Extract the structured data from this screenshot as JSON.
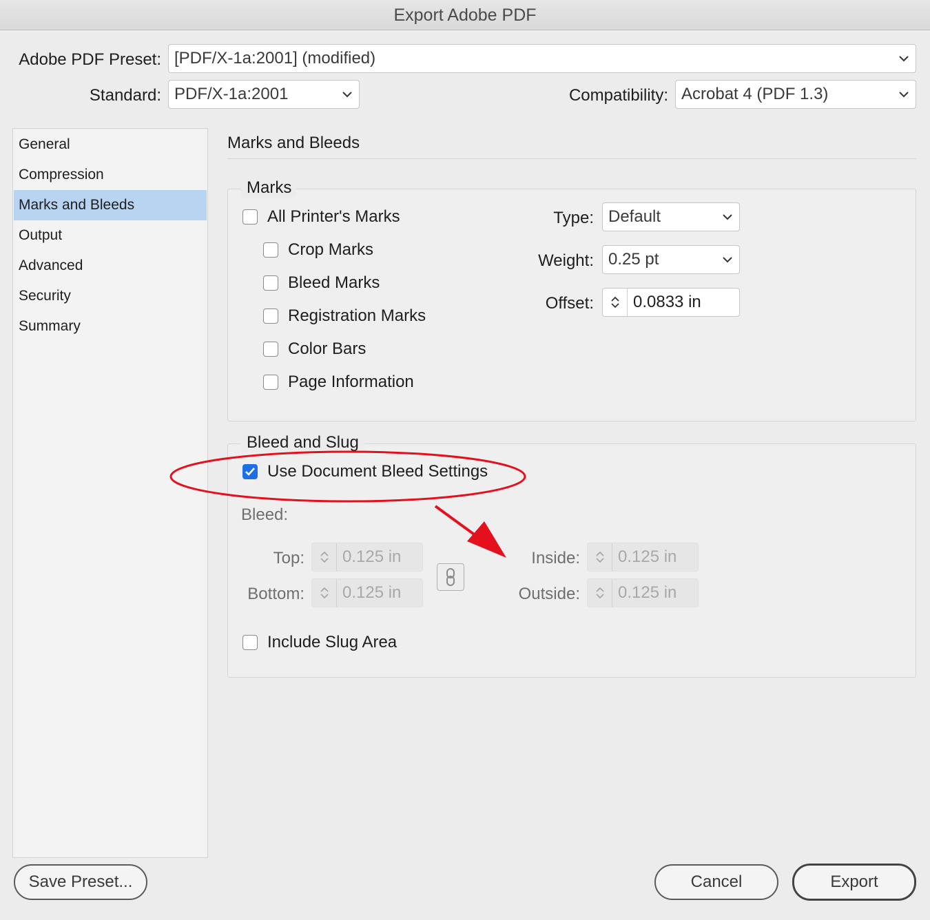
{
  "window": {
    "title": "Export Adobe PDF"
  },
  "preset": {
    "label": "Adobe PDF Preset:",
    "value": "[PDF/X-1a:2001] (modified)"
  },
  "standard": {
    "label": "Standard:",
    "value": "PDF/X-1a:2001"
  },
  "compatibility": {
    "label": "Compatibility:",
    "value": "Acrobat 4 (PDF 1.3)"
  },
  "sidebar": {
    "items": [
      {
        "label": "General"
      },
      {
        "label": "Compression"
      },
      {
        "label": "Marks and Bleeds",
        "selected": true
      },
      {
        "label": "Output"
      },
      {
        "label": "Advanced"
      },
      {
        "label": "Security"
      },
      {
        "label": "Summary"
      }
    ]
  },
  "main": {
    "heading": "Marks and Bleeds",
    "marks": {
      "title": "Marks",
      "all_printers_marks": {
        "label": "All Printer's Marks",
        "checked": false
      },
      "crop_marks": {
        "label": "Crop Marks",
        "checked": false
      },
      "bleed_marks": {
        "label": "Bleed Marks",
        "checked": false
      },
      "registration_marks": {
        "label": "Registration Marks",
        "checked": false
      },
      "color_bars": {
        "label": "Color Bars",
        "checked": false
      },
      "page_information": {
        "label": "Page Information",
        "checked": false
      },
      "type": {
        "label": "Type:",
        "value": "Default"
      },
      "weight": {
        "label": "Weight:",
        "value": "0.25 pt"
      },
      "offset": {
        "label": "Offset:",
        "value": "0.0833 in"
      }
    },
    "bleed_slug": {
      "title": "Bleed and Slug",
      "use_document_bleed": {
        "label": "Use Document Bleed Settings",
        "checked": true
      },
      "bleed_label": "Bleed:",
      "top": {
        "label": "Top:",
        "value": "0.125 in"
      },
      "bottom": {
        "label": "Bottom:",
        "value": "0.125 in"
      },
      "inside": {
        "label": "Inside:",
        "value": "0.125 in"
      },
      "outside": {
        "label": "Outside:",
        "value": "0.125 in"
      },
      "include_slug": {
        "label": "Include Slug Area",
        "checked": false
      }
    }
  },
  "footer": {
    "save_preset": "Save Preset...",
    "cancel": "Cancel",
    "export": "Export"
  },
  "colors": {
    "selection": "#b9d4f0",
    "checkbox_on": "#1e6fe6",
    "annotation": "#e4101e"
  },
  "icons": [
    "chevron-down-icon",
    "stepper-arrows-icon",
    "link-chain-icon",
    "checkmark-icon"
  ]
}
